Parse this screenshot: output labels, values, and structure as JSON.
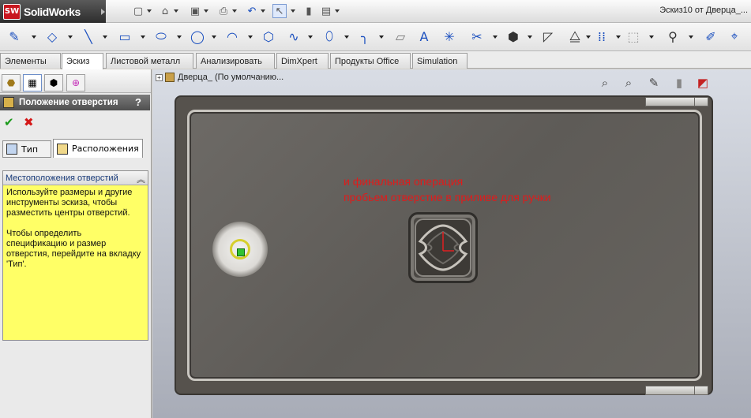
{
  "app": {
    "name": "SolidWorks",
    "document_title": "Эскиз10 от Дверца_..."
  },
  "command_tabs": [
    {
      "label": "Элементы",
      "active": false
    },
    {
      "label": "Эскиз",
      "active": true
    },
    {
      "label": "Листовой металл",
      "active": false
    },
    {
      "label": "Анализировать",
      "active": false
    },
    {
      "label": "DimXpert",
      "active": false
    },
    {
      "label": "Продукты Office",
      "active": false
    },
    {
      "label": "Simulation",
      "active": false
    }
  ],
  "property_manager": {
    "title": "Положение отверстия",
    "help": "?",
    "ok_label": "✔",
    "cancel_label": "✖",
    "tabs": {
      "type_label": "Тип",
      "positions_label": "Расположения"
    },
    "positions_section": {
      "header": "Местоположения отверстий",
      "paragraph1": "Используйте размеры и другие инструменты эскиза, чтобы разместить центры отверстий.",
      "paragraph2": "Чтобы определить спецификацию и размер отверстия, перейдите на вкладку 'Тип'."
    }
  },
  "feature_tree": {
    "item": "Дверца_ (По умолчанию..."
  },
  "annotation": {
    "line1": "и финальная операция",
    "line2": "пробьем отверстие в приливе для ручки",
    "color": "#e01b1b"
  },
  "icons": {
    "toolbar": [
      "new-icon",
      "open-icon",
      "save-icon",
      "print-icon",
      "undo-icon",
      "select-icon",
      "rebuild-icon",
      "options-icon"
    ],
    "sketch": [
      "smart-dimension-icon",
      "line-icon",
      "rectangle-icon",
      "slot-icon",
      "circle-icon",
      "arc-icon",
      "polygon-icon",
      "spline-icon",
      "ellipse-icon",
      "fillet-icon",
      "plane-icon",
      "text-icon",
      "point-icon",
      "trim-icon",
      "offset-icon",
      "mirror-icon",
      "move-icon",
      "pattern-icon",
      "display-relations-icon",
      "repair-icon",
      "quick-snaps-icon"
    ],
    "view": [
      "zoom-fit-icon",
      "zoom-area-icon",
      "previous-view-icon",
      "section-view-icon",
      "view-orientation-icon"
    ]
  }
}
